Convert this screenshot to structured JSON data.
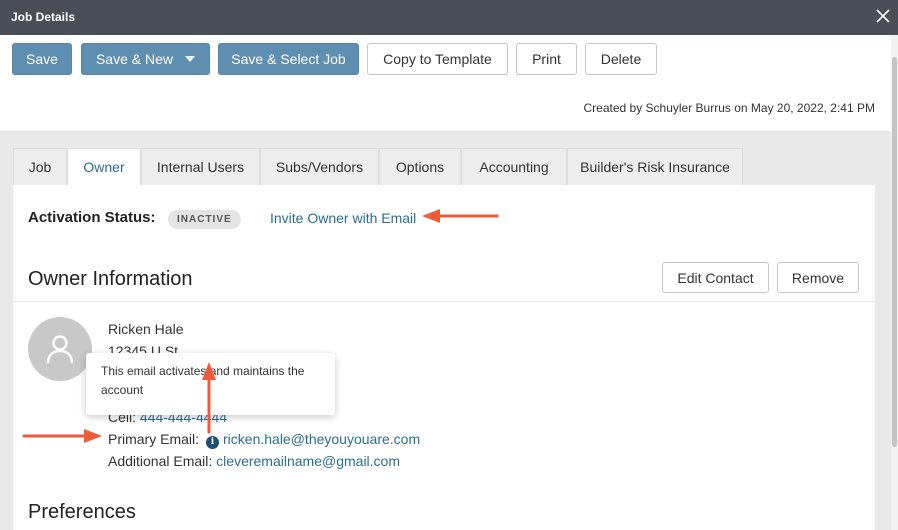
{
  "window": {
    "title": "Job Details",
    "close_icon": "close-icon"
  },
  "toolbar": {
    "save": "Save",
    "save_new": "Save & New",
    "save_select": "Save & Select Job",
    "copy_template": "Copy to Template",
    "print": "Print",
    "delete": "Delete",
    "created_by": "Created by Schuyler Burrus on May 20, 2022, 2:41 PM"
  },
  "tabs": [
    {
      "label": "Job"
    },
    {
      "label": "Owner",
      "active": true
    },
    {
      "label": "Internal Users"
    },
    {
      "label": "Subs/Vendors"
    },
    {
      "label": "Options"
    },
    {
      "label": "Accounting"
    },
    {
      "label": "Builder's Risk Insurance"
    }
  ],
  "activation": {
    "label": "Activation Status:",
    "status": "INACTIVE",
    "invite_link": "Invite Owner with Email"
  },
  "owner": {
    "section_title": "Owner Information",
    "edit_button": "Edit Contact",
    "remove_button": "Remove",
    "name": "Ricken Hale",
    "address": "12345 U St",
    "cell_label": "Cell:",
    "cell_value": "444-444-4444",
    "primary_email_label": "Primary Email:",
    "primary_email": "ricken.hale@theyouyouare.com",
    "additional_email_label": "Additional Email:",
    "additional_email": "cleveremailname@gmail.com"
  },
  "tooltip": {
    "text": "This email activates and maintains the account"
  },
  "preferences": {
    "title": "Preferences"
  },
  "colors": {
    "accent": "#2a6f93",
    "primary_button": "#5f8fb0",
    "titlebar": "#4a4e57",
    "annotation_arrow": "#ee5b3a"
  }
}
